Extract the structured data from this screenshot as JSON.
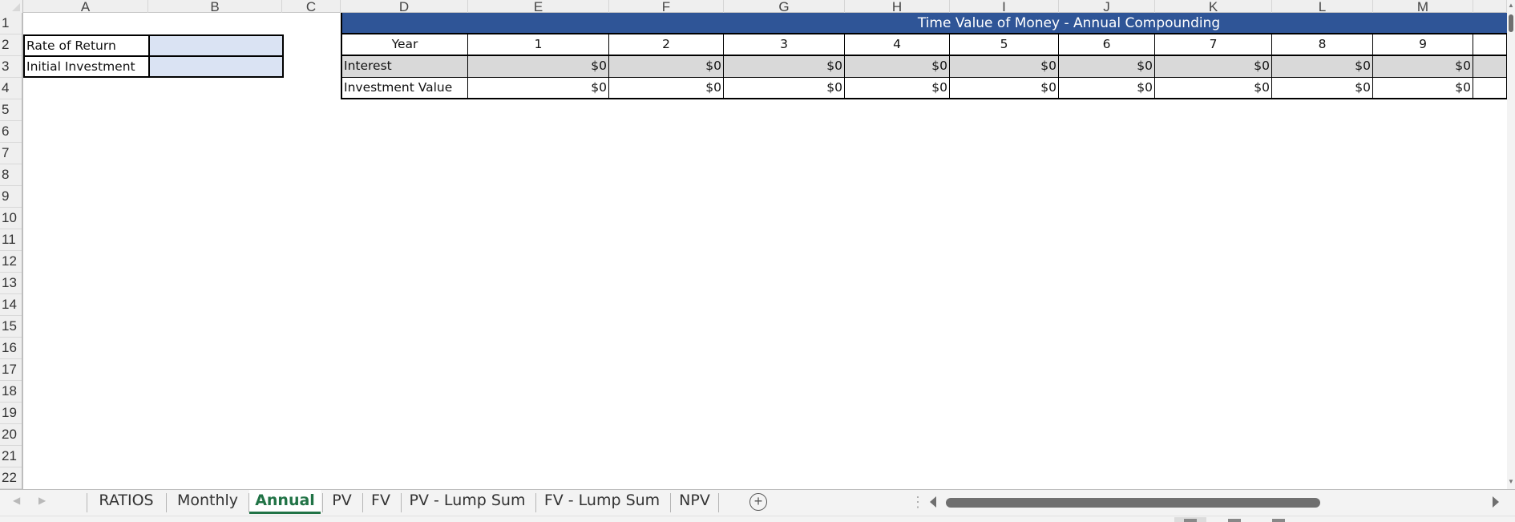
{
  "columns": [
    "A",
    "B",
    "C",
    "D",
    "E",
    "F",
    "G",
    "H",
    "I",
    "J",
    "K",
    "L",
    "M"
  ],
  "rows": [
    "1",
    "2",
    "3",
    "4",
    "5",
    "6",
    "7",
    "8",
    "9",
    "10",
    "11",
    "12",
    "13",
    "14",
    "15",
    "16",
    "17",
    "18",
    "19",
    "20",
    "21",
    "22"
  ],
  "inputs": {
    "rate_of_return": {
      "label": "Rate of Return",
      "value": ""
    },
    "initial_investment": {
      "label": "Initial Investment",
      "value": ""
    }
  },
  "tvm_table": {
    "title": "Time Value of Money - Annual Compounding",
    "year_label": "Year",
    "interest_label": "Interest",
    "value_label": "Investment Value",
    "years": [
      "1",
      "2",
      "3",
      "4",
      "5",
      "6",
      "7",
      "8",
      "9",
      ""
    ],
    "interest": [
      "$0",
      "$0",
      "$0",
      "$0",
      "$0",
      "$0",
      "$0",
      "$0",
      "$0",
      ""
    ],
    "investment_value": [
      "$0",
      "$0",
      "$0",
      "$0",
      "$0",
      "$0",
      "$0",
      "$0",
      "$0",
      ""
    ]
  },
  "sheet_tabs": [
    {
      "label": "RATIOS",
      "active": false
    },
    {
      "label": "Monthly",
      "active": false
    },
    {
      "label": "Annual",
      "active": true
    },
    {
      "label": "PV",
      "active": false
    },
    {
      "label": "FV",
      "active": false
    },
    {
      "label": "PV - Lump Sum",
      "active": false
    },
    {
      "label": "FV - Lump Sum",
      "active": false
    },
    {
      "label": "NPV",
      "active": false
    }
  ],
  "icons": {
    "add_sheet": "+",
    "tab_prev": "◀",
    "tab_next": "▶",
    "splitter": "⋮"
  },
  "colors": {
    "title_fill": "#2f5597",
    "input_fill": "#dae3f3",
    "interest_row_fill": "#d9d9d9",
    "active_tab": "#217346"
  }
}
